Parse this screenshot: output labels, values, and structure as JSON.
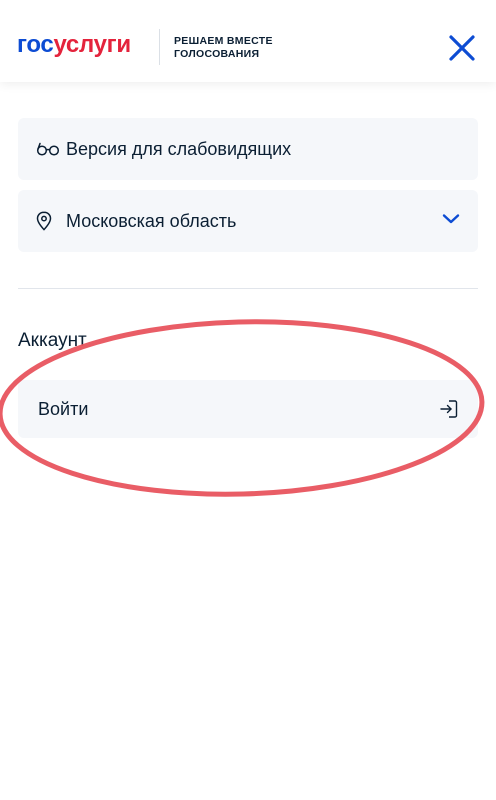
{
  "header": {
    "logo_part1": "гос",
    "logo_part2": "услуги",
    "tagline_line1": "РЕШАЕМ ВМЕСТЕ",
    "tagline_line2": "ГОЛОСОВАНИЯ",
    "close_icon": "close-icon"
  },
  "menu": {
    "low_vision_label": "Версия для слабовидящих",
    "low_vision_icon": "glasses-icon",
    "region_label": "Московская область",
    "region_icon": "location-pin-icon",
    "region_chevron_icon": "chevron-down-icon"
  },
  "account": {
    "title": "Аккаунт",
    "login_label": "Войти",
    "login_icon": "sign-in-icon"
  },
  "annotation": {
    "shape": "ellipse",
    "color": "#e8545e"
  },
  "colors": {
    "brand_blue": "#0d4cd3",
    "brand_red": "#e4233c",
    "card_bg": "#f5f7fa",
    "text": "#0b1f33"
  }
}
